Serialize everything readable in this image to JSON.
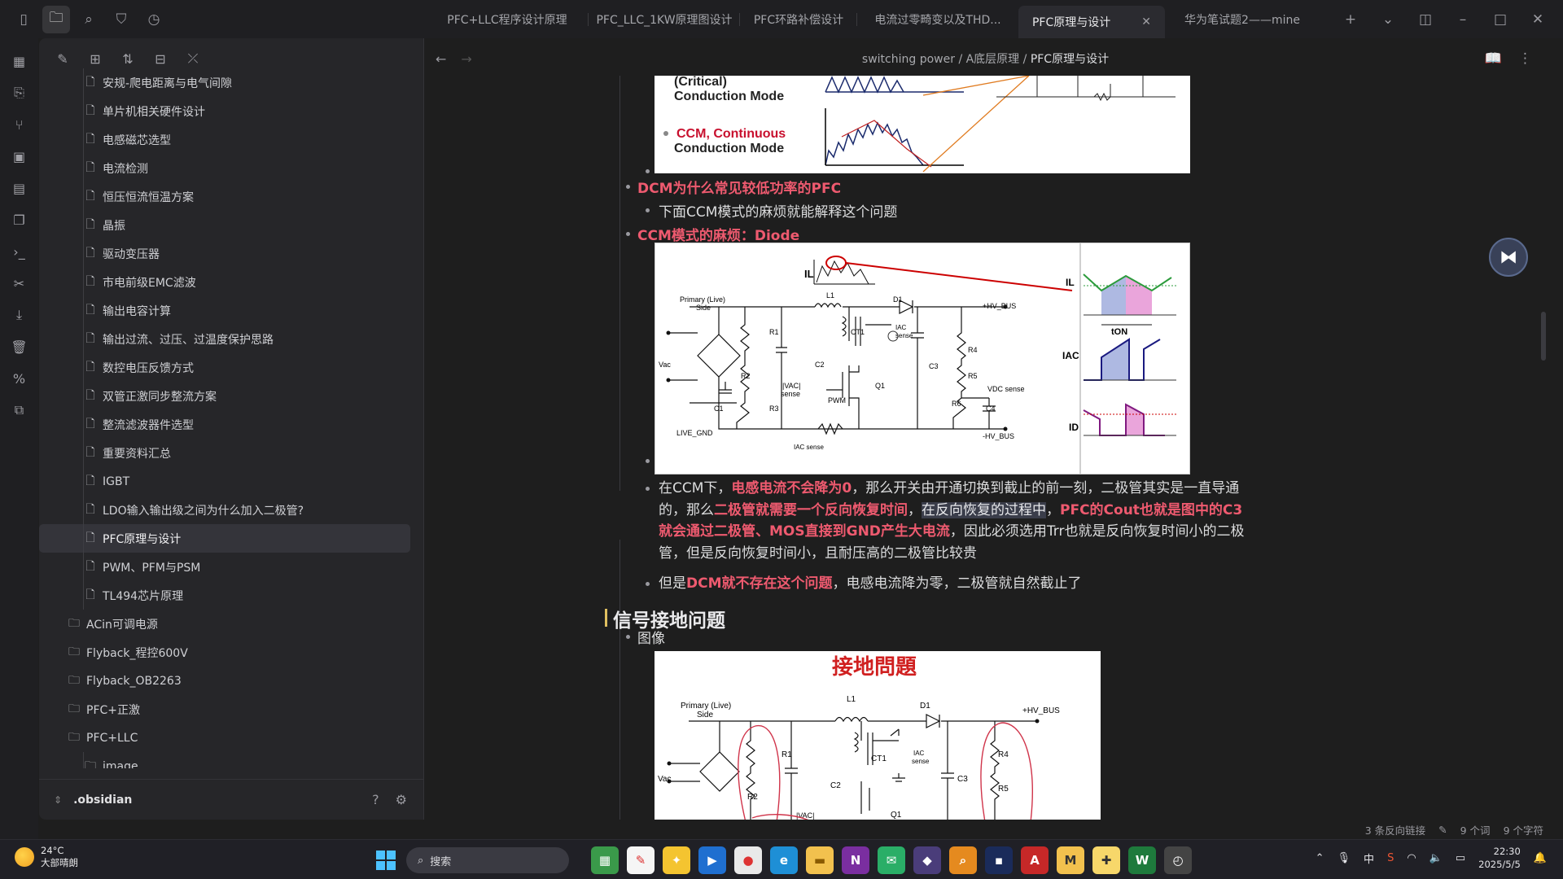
{
  "tabs": [
    {
      "label": "PFC+LLC程序设计原理"
    },
    {
      "label": "PFC_LLC_1KW原理图设计"
    },
    {
      "label": "PFC环路补偿设计"
    },
    {
      "label": "电流过零畸变以及THD..."
    },
    {
      "label": "PFC原理与设计",
      "close": "✕"
    },
    {
      "label": "华为笔试题2——mine"
    }
  ],
  "sidebar": {
    "files": [
      "安规-爬电距离与电气间隙",
      "单片机相关硬件设计",
      "电感磁芯选型",
      "电流检测",
      "恒压恒流恒温方案",
      "晶振",
      "驱动变压器",
      "市电前级EMC滤波",
      "输出电容计算",
      "输出过流、过压、过温度保护思路",
      "数控电压反馈方式",
      "双管正激同步整流方案",
      "整流滤波器件选型",
      "重要资料汇总",
      "IGBT",
      "LDO输入输出级之间为什么加入二极管?",
      "PFC原理与设计",
      "PWM、PFM与PSM",
      "TL494芯片原理"
    ],
    "folders": [
      "ACin可调电源",
      "Flyback_程控600V",
      "Flyback_OB2263",
      "PFC+正激",
      "PFC+LLC"
    ],
    "subfolder": "image",
    "vault": ".obsidian"
  },
  "breadcrumb": {
    "part1": "switching power",
    "sep": "/",
    "part2": "A底层原理",
    "part3": "PFC原理与设计"
  },
  "doc": {
    "img1_t1a": "(Critical)",
    "img1_t1b": "Conduction Mode",
    "img1_t2a": "CCM, Continuous",
    "img1_t2b": "Conduction Mode",
    "b1": "DCM为什么常见较低功率的PFC",
    "b1_1": "下面CCM模式的麻烦就能解释这个问题",
    "b2": "CCM模式的麻烦：Diode",
    "p1_a": "在CCM下，",
    "p1_b": "电感电流不会降为0",
    "p1_c": "，那么开关由开通切换到截止的前一刻，二极管其实是一直",
    "p1_d": "导通的，那么",
    "p1_e": "二极管就需要一个反向恢复时间",
    "p1_f": "，",
    "p1_g": "在反向恢复的过程中",
    "p1_h": "，",
    "p1_i": "PFC的Cout也就是图",
    "p1_j": "中的C3就会通过二极管、MOS直接到GND产生大电流",
    "p1_k": "，因此必须选用Trr也就是反向恢复时",
    "p1_l": "间小的二极管，但是反向恢复时间小，且耐压高的二极管比较贵",
    "p2_a": "但是",
    "p2_b": "DCM就不存在这个问题",
    "p2_c": "，电感电流降为零，二极管就自然截止了",
    "h2": "信号接地问题",
    "b3": "图像",
    "img3_title": "接地問題"
  },
  "circuit": {
    "primary": "Primary (Live)",
    "side": "Side",
    "vac": "Vac",
    "l1": "L1",
    "d1": "D1",
    "hvbus": "+HV_BUS",
    "hvbus2": "-HV_BUS",
    "livegnd": "LIVE_GND",
    "r1": "R1",
    "r2": "R2",
    "r3": "R3",
    "r4": "R4",
    "r5": "R5",
    "r6": "R6",
    "c1": "C1",
    "c2": "C2",
    "c3": "C3",
    "c4": "C4",
    "ct1": "CT1",
    "q1": "Q1",
    "pwm": "PWM",
    "vac_sense": "|VAC|",
    "sense": "sense",
    "iac_sense": "IAC sense",
    "iac": "IAC",
    "vdc_sense": "VDC sense",
    "il": "IL",
    "iac_lbl": "IAC",
    "id": "ID",
    "ton": "tON"
  },
  "status": {
    "backlinks": "3 条反向链接",
    "words": "9 个词",
    "chars": "9 个字符"
  },
  "taskbar": {
    "temp": "24°C",
    "weather": "大部晴朗",
    "search": "搜索",
    "ime": "中",
    "time": "22:30",
    "date": "2025/5/5"
  }
}
